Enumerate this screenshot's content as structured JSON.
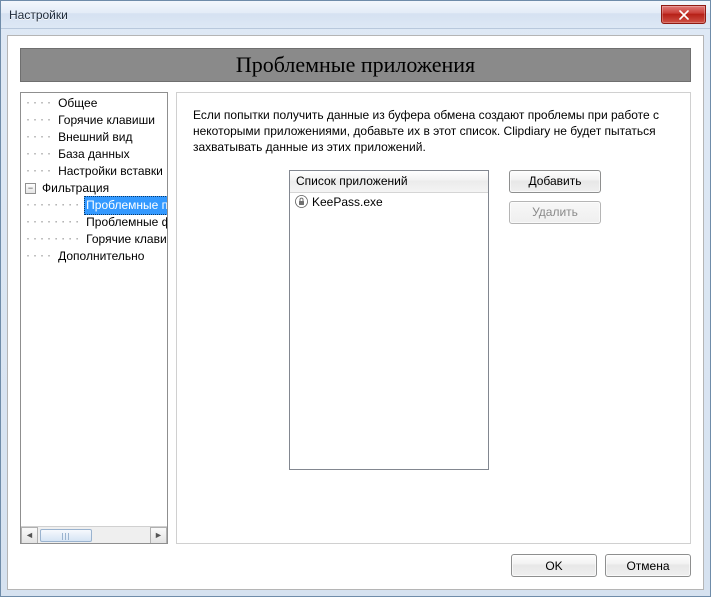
{
  "window": {
    "title": "Настройки"
  },
  "banner": {
    "title": "Проблемные приложения"
  },
  "tree": {
    "items": [
      {
        "label": "Общее"
      },
      {
        "label": "Горячие клавиши"
      },
      {
        "label": "Внешний вид"
      },
      {
        "label": "База данных"
      },
      {
        "label": "Настройки вставки"
      },
      {
        "label": "Фильтрация",
        "expanded": true
      },
      {
        "label": "Проблемные приложения",
        "selected": true
      },
      {
        "label": "Проблемные форматы"
      },
      {
        "label": "Горячие клавиши"
      },
      {
        "label": "Дополнительно"
      }
    ]
  },
  "content": {
    "description": "Если попытки получить данные из буфера обмена создают проблемы при работе с некоторыми приложениями, добавьте их в этот список. Clipdiary не будет пытаться захватывать данные из этих приложений.",
    "list_header": "Список приложений",
    "apps": [
      {
        "name": "KeePass.exe"
      }
    ],
    "buttons": {
      "add": "Добавить",
      "remove": "Удалить"
    }
  },
  "footer": {
    "ok": "OK",
    "cancel": "Отмена"
  }
}
